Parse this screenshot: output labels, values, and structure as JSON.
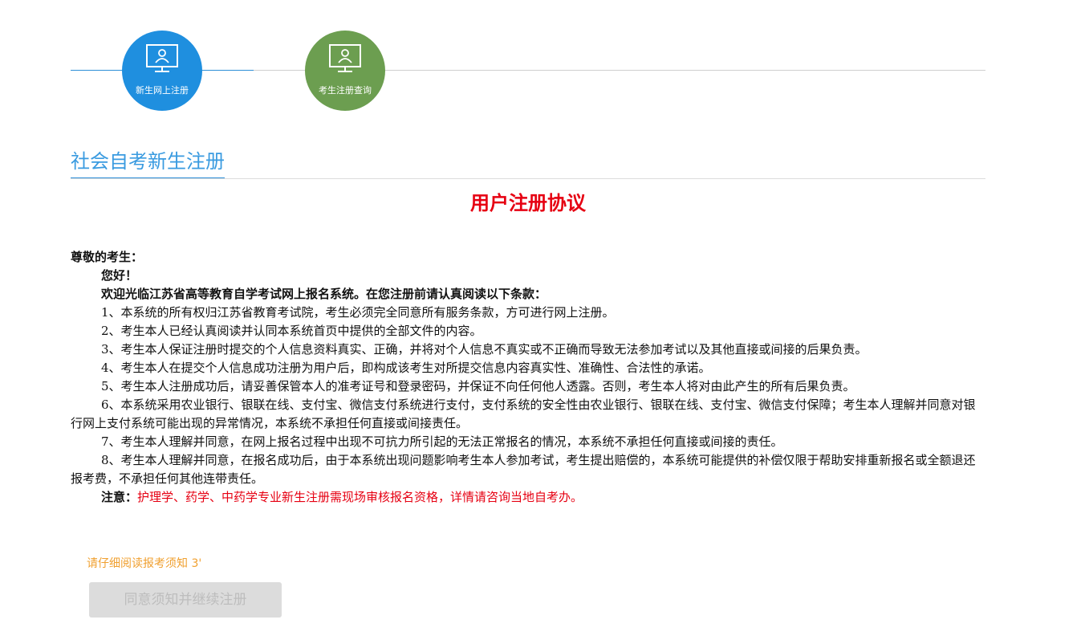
{
  "steps": [
    {
      "label": "新生网上注册",
      "icon": "user-monitor-icon",
      "color": "#1f8fdf",
      "active": true
    },
    {
      "label": "考生注册查询",
      "icon": "user-monitor-icon",
      "color": "#6c9e50",
      "active": false
    }
  ],
  "section": {
    "title": "社会自考新生注册"
  },
  "agreement": {
    "title": "用户注册协议",
    "salutation": "尊敬的考生：",
    "greeting": "您好！",
    "intro": "欢迎光临江苏省高等教育自学考试网上报名系统。在您注册前请认真阅读以下条款：",
    "clauses": [
      "1、本系统的所有权归江苏省教育考试院，考生必须完全同意所有服务条款，方可进行网上注册。",
      "2、考生本人已经认真阅读并认同本系统首页中提供的全部文件的内容。",
      "3、考生本人保证注册时提交的个人信息资料真实、正确，并将对个人信息不真实或不正确而导致无法参加考试以及其他直接或间接的后果负责。",
      "4、考生本人在提交个人信息成功注册为用户后，即构成该考生对所提交信息内容真实性、准确性、合法性的承诺。",
      "5、考生本人注册成功后，请妥善保管本人的准考证号和登录密码，并保证不向任何他人透露。否则，考生本人将对由此产生的所有后果负责。",
      "6、本系统采用农业银行、银联在线、支付宝、微信支付系统进行支付，支付系统的安全性由农业银行、银联在线、支付宝、微信支付保障；考生本人理解并同意对银行网上支付系统可能出现的异常情况，本系统不承担任何直接或间接责任。",
      "7、考生本人理解并同意，在网上报名过程中出现不可抗力所引起的无法正常报名的情况，本系统不承担任何直接或间接的责任。",
      "8、考生本人理解并同意，在报名成功后，由于本系统出现问题影响考生本人参加考试，考生提出赔偿的，本系统可能提供的补偿仅限于帮助安排重新报名或全额退还报考费，不承担任何其他连带责任。"
    ],
    "note_label": "注意：",
    "note_text": "护理学、药学、中药学专业新生注册需现场审核报名资格，详情请咨询当地自考办。"
  },
  "countdown": "请仔细阅读报考须知 3'",
  "agree_button": {
    "label": "同意须知并继续注册",
    "disabled": true
  },
  "colors": {
    "accent_blue": "#1f8fdf",
    "accent_green": "#6c9e50",
    "warning_red": "#e60012",
    "countdown_orange": "#f0a030"
  }
}
